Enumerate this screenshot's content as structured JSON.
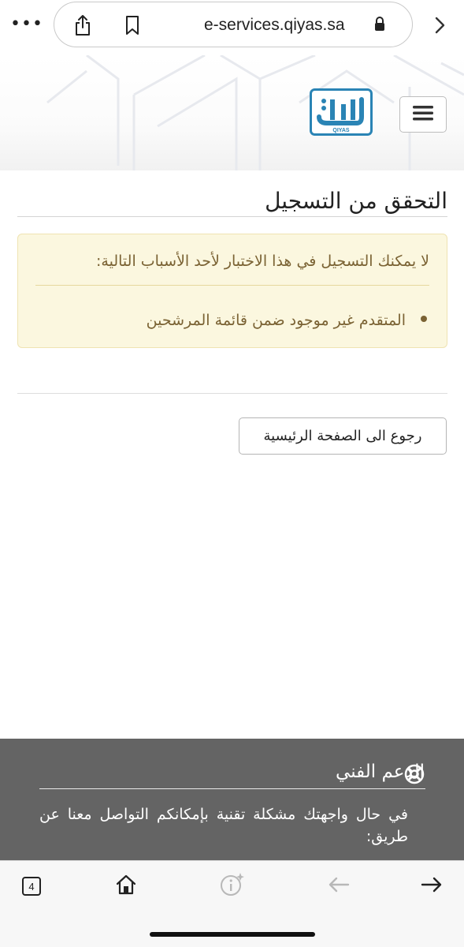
{
  "browser": {
    "url": "e-services.qiyas.sa",
    "more_label": "•••",
    "tab_count": "4"
  },
  "header": {
    "logo_text": "QIYAS"
  },
  "main": {
    "title": "التحقق من التسجيل",
    "alert": {
      "heading": "لا يمكنك التسجيل في هذا الاختبار لأحد الأسباب التالية:",
      "reasons": [
        "المتقدم غير موجود ضمن قائمة المرشحين"
      ]
    },
    "home_button_label": "رجوع الى الصفحة الرئيسية"
  },
  "support": {
    "title": "الدعم الفني",
    "text": "في حال واجهتك مشكلة تقنية بإمكانكم التواصل معنا عن طريق:"
  },
  "colors": {
    "alert_bg": "#fbf7df",
    "alert_text": "#7a6233",
    "support_bg": "#646464",
    "logo_blue": "#2a84b5"
  }
}
